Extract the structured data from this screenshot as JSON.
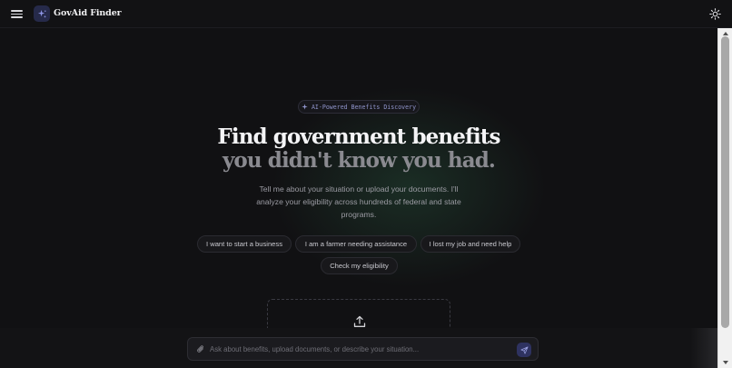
{
  "header": {
    "brand": "GovAid Finder",
    "menu_icon": "hamburger-icon",
    "theme_icon": "sun-icon",
    "logo_icon": "sparkle-icon"
  },
  "hero": {
    "badge": "AI-Powered Benefits Discovery",
    "headline_line1": "Find government benefits",
    "headline_line2": "you didn't know you had.",
    "subtitle": "Tell me about your situation or upload your documents. I'll analyze your eligibility across hundreds of federal and state programs."
  },
  "chips": [
    "I want to start a business",
    "I am a farmer needing assistance",
    "I lost my job and need help",
    "Check my eligibility"
  ],
  "upload": {
    "icon": "upload-icon"
  },
  "chat": {
    "placeholder": "Ask about benefits, upload documents, or describe your situation...",
    "value": "",
    "attach_icon": "paperclip-icon",
    "send_icon": "send-icon"
  },
  "colors": {
    "background": "#111113",
    "accent": "#2e3260",
    "badge_text": "#8e93c9",
    "glow": "#26503a"
  }
}
